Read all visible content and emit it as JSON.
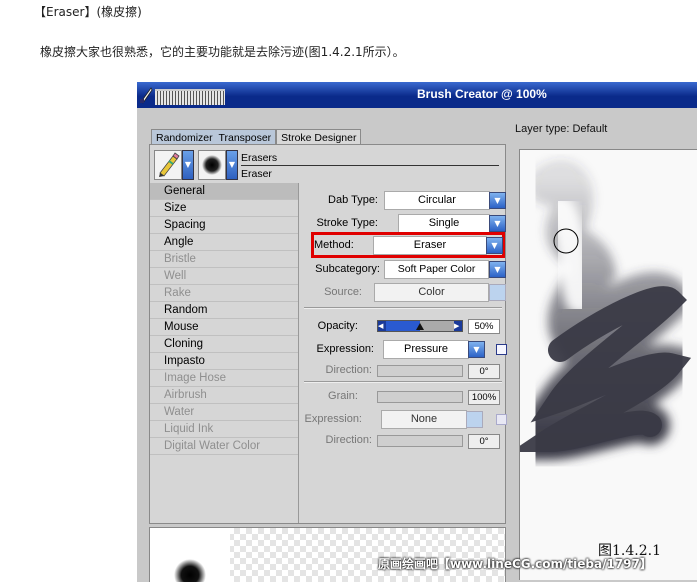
{
  "article": {
    "heading": "【Eraser】(橡皮擦)",
    "paragraph": "橡皮擦大家也很熟悉，它的主要功能就是去除污迹(图1.4.2.1所示）。",
    "figure_caption": "图1.4.2.1",
    "watermark": "原画绘画吧【www.lineCG.com/tieba/1797】"
  },
  "window": {
    "title": "Brush Creator @ 100%",
    "tabs": [
      "Randomizer",
      "Transposer",
      "Stroke Designer"
    ],
    "layer_type": "Layer type: Default"
  },
  "brush": {
    "category": "Erasers",
    "variant": "Eraser"
  },
  "categories": [
    {
      "label": "General",
      "enabled": true,
      "selected": true
    },
    {
      "label": "Size",
      "enabled": true
    },
    {
      "label": "Spacing",
      "enabled": true
    },
    {
      "label": "Angle",
      "enabled": true
    },
    {
      "label": "Bristle",
      "enabled": false
    },
    {
      "label": "Well",
      "enabled": false
    },
    {
      "label": "Rake",
      "enabled": false
    },
    {
      "label": "Random",
      "enabled": true
    },
    {
      "label": "Mouse",
      "enabled": true
    },
    {
      "label": "Cloning",
      "enabled": true
    },
    {
      "label": "Impasto",
      "enabled": true
    },
    {
      "label": "Image Hose",
      "enabled": false
    },
    {
      "label": "Airbrush",
      "enabled": false
    },
    {
      "label": "Water",
      "enabled": false
    },
    {
      "label": "Liquid Ink",
      "enabled": false
    },
    {
      "label": "Digital Water Color",
      "enabled": false
    }
  ],
  "general": {
    "dab_type_label": "Dab Type:",
    "dab_type": "Circular",
    "stroke_type_label": "Stroke Type:",
    "stroke_type": "Single",
    "method_label": "Method:",
    "method": "Eraser",
    "subcategory_label": "Subcategory:",
    "subcategory": "Soft Paper Color",
    "source_label": "Source:",
    "source": "Color",
    "opacity_label": "Opacity:",
    "opacity": "50%",
    "opacity_fraction": 0.5,
    "expression_label": "Expression:",
    "expression": "Pressure",
    "direction_label": "Direction:",
    "direction": "0°",
    "grain_label": "Grain:",
    "grain": "100%",
    "grain_expression_label": "Expression:",
    "grain_expression": "None",
    "grain_direction_label": "Direction:",
    "grain_direction": "0°"
  },
  "colors": {
    "highlight": "#e00000",
    "titlebar": "#0a2a8a",
    "panel": "#d6d6d6"
  }
}
